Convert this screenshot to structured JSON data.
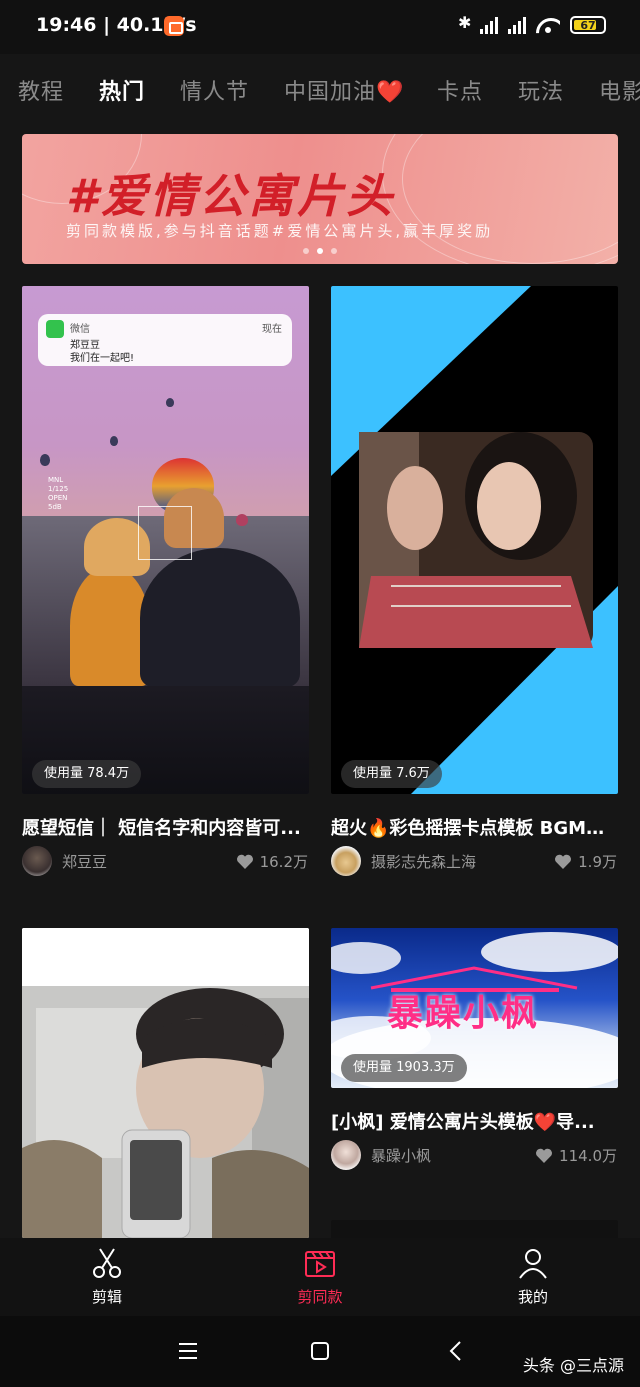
{
  "status_bar": {
    "time": "19:46 | 40.1K/s",
    "battery": "67"
  },
  "tabs": [
    "教程",
    "热门",
    "情人节",
    "中国加油❤️",
    "卡点",
    "玩法",
    "电影"
  ],
  "active_tab": 1,
  "banner": {
    "title": "#爱情公寓片头",
    "subtitle": "剪同款模版,参与抖音话题#爱情公寓片头,赢丰厚奖励"
  },
  "cards": [
    {
      "usage": "使用量 78.4万",
      "title": "愿望短信｜ 短信名字和内容皆可...",
      "author": "郑豆豆",
      "likes": "16.2万",
      "notification": {
        "app": "微信",
        "time": "现在",
        "name": "郑豆豆",
        "message": "我们在一起吧!"
      },
      "camera_text": [
        "MNL",
        "1/125",
        "OPEN",
        "5dB"
      ]
    },
    {
      "usage": "使用量 7.6万",
      "title": "超火🔥彩色摇摆卡点模板 BGM：...",
      "author": "摄影志先森上海",
      "likes": "1.9万"
    },
    {
      "title": ""
    },
    {
      "usage": "使用量 1903.3万",
      "title": "[小枫] 爱情公寓片头模板❤️导...",
      "author": "暴躁小枫",
      "likes": "114.0万",
      "artwork_text": "暴躁小枫"
    }
  ],
  "bottom_nav": [
    {
      "label": "剪辑",
      "icon": "scissors-icon"
    },
    {
      "label": "剪同款",
      "icon": "clapperboard-icon"
    },
    {
      "label": "我的",
      "icon": "profile-icon"
    }
  ],
  "active_nav": 1,
  "watermark": "头条 @三点源",
  "colors": {
    "accent": "#fe2c55",
    "background": "#161616"
  }
}
